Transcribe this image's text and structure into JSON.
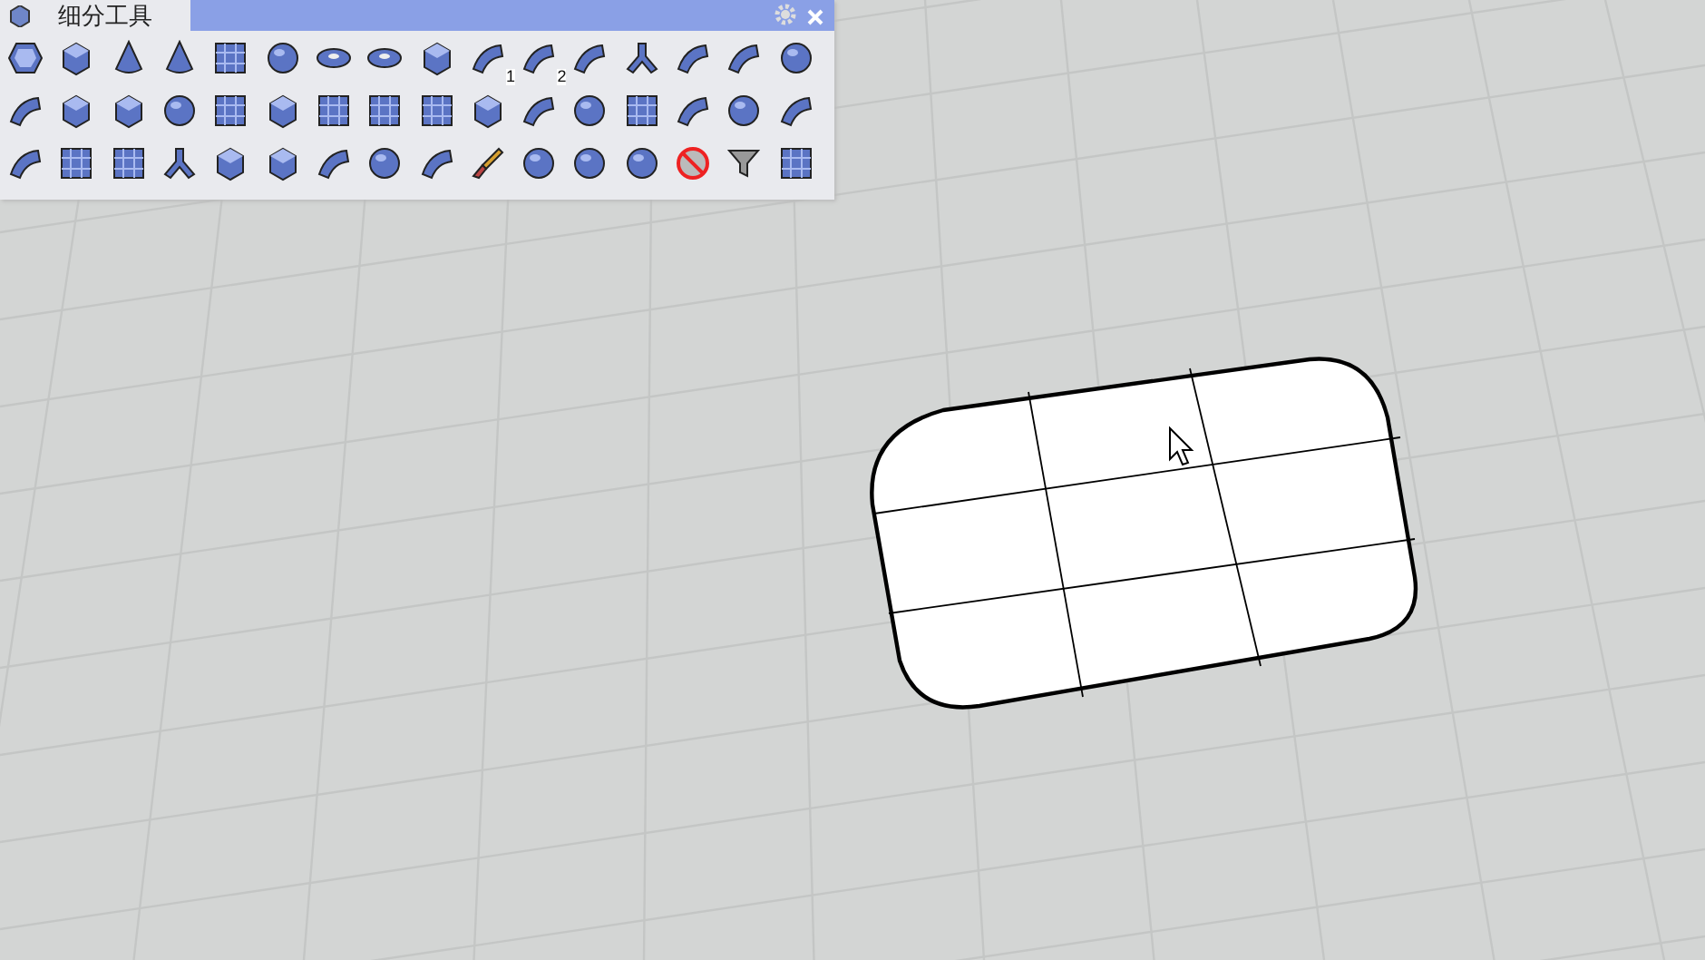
{
  "toolbar": {
    "title": "细分工具",
    "rows": [
      [
        {
          "kind": "polygon"
        },
        {
          "kind": "box"
        },
        {
          "kind": "cone"
        },
        {
          "kind": "cone"
        },
        {
          "kind": "grid"
        },
        {
          "kind": "sphere"
        },
        {
          "kind": "torus"
        },
        {
          "kind": "torus"
        },
        {
          "kind": "box"
        },
        {
          "kind": "surface",
          "badge": "1"
        },
        {
          "kind": "surface",
          "badge": "2"
        },
        {
          "kind": "surface"
        },
        {
          "kind": "branch"
        },
        {
          "kind": "surface"
        },
        {
          "kind": "surface"
        },
        {
          "kind": "sphere"
        }
      ],
      [
        {
          "kind": "surface"
        },
        {
          "kind": "box"
        },
        {
          "kind": "box"
        },
        {
          "kind": "sphere"
        },
        {
          "kind": "grid"
        },
        {
          "kind": "box"
        },
        {
          "kind": "grid"
        },
        {
          "kind": "grid"
        },
        {
          "kind": "grid"
        },
        {
          "kind": "box"
        },
        {
          "kind": "surface"
        },
        {
          "kind": "sphere"
        },
        {
          "kind": "grid"
        },
        {
          "kind": "surface"
        },
        {
          "kind": "sphere"
        },
        {
          "kind": "surface"
        }
      ],
      [
        {
          "kind": "surface"
        },
        {
          "kind": "grid"
        },
        {
          "kind": "grid"
        },
        {
          "kind": "branch"
        },
        {
          "kind": "box"
        },
        {
          "kind": "box"
        },
        {
          "kind": "surface"
        },
        {
          "kind": "sphere"
        },
        {
          "kind": "surface"
        },
        {
          "kind": "brush"
        },
        {
          "kind": "sphere"
        },
        {
          "kind": "sphere"
        },
        {
          "kind": "sphere"
        },
        {
          "kind": "forbidden"
        },
        {
          "kind": "filter"
        },
        {
          "kind": "grid"
        }
      ]
    ]
  }
}
